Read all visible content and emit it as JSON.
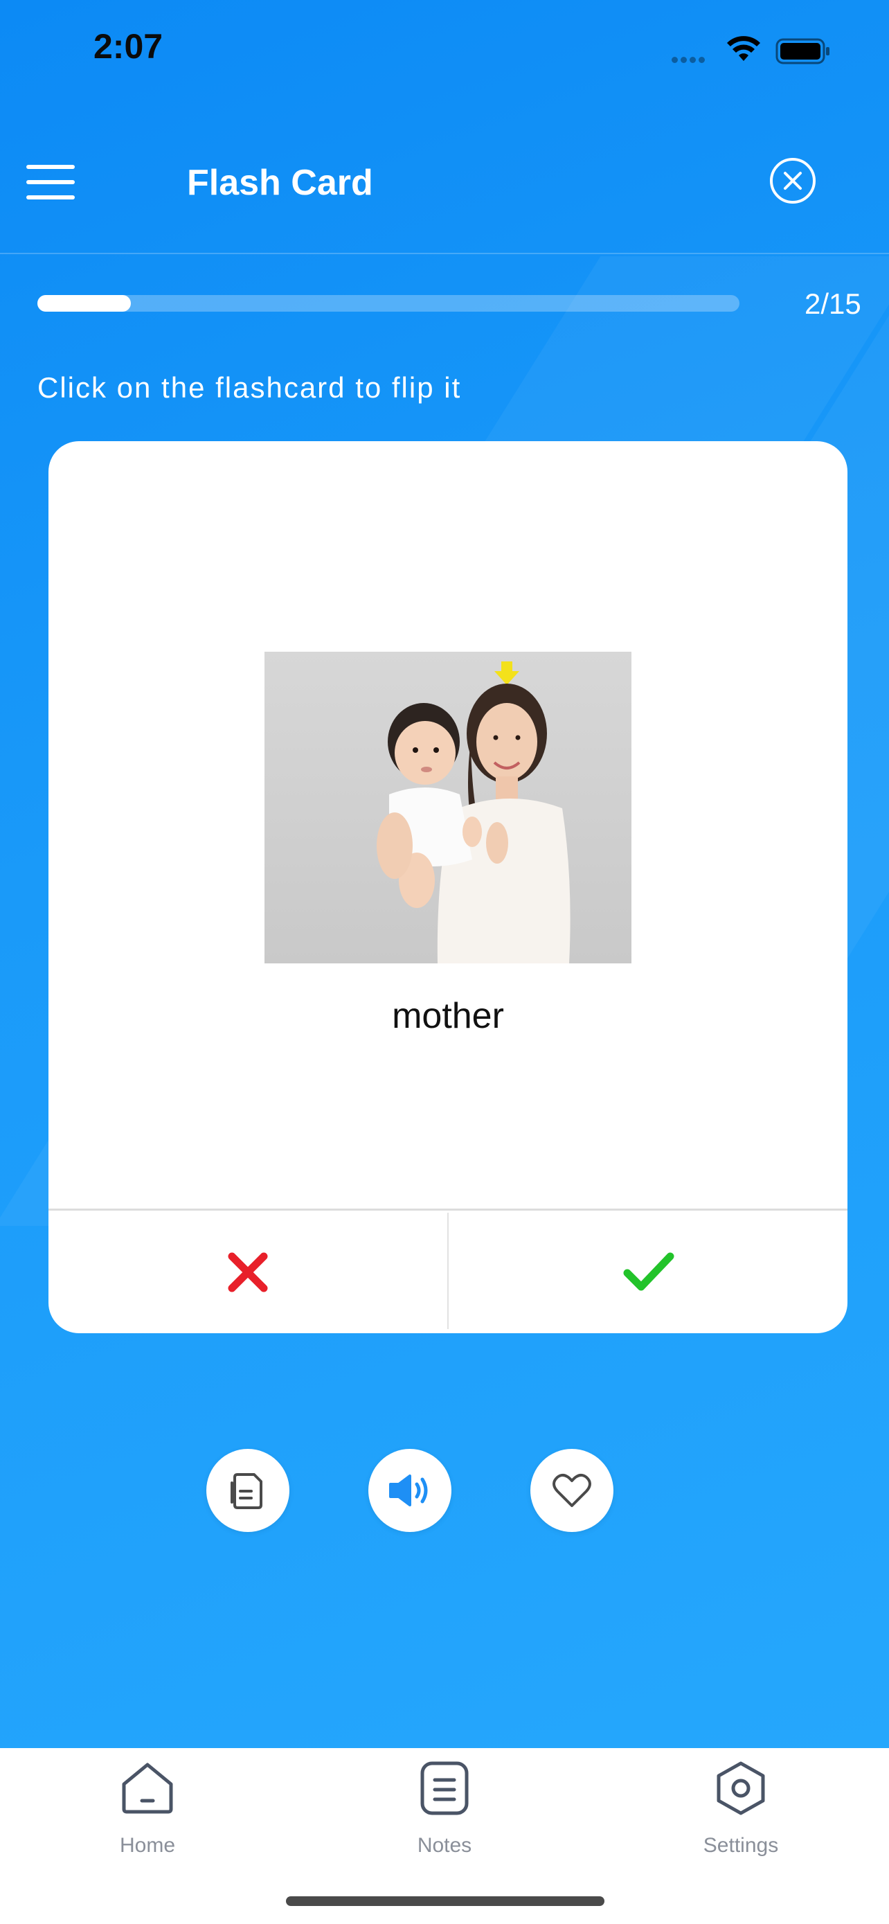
{
  "status_bar": {
    "time": "2:07"
  },
  "header": {
    "title": "Flash Card"
  },
  "progress": {
    "current": 2,
    "total": 15,
    "label": "2/15",
    "fraction": 0.1333
  },
  "instruction": "Click on the flashcard to flip it",
  "card": {
    "word": "mother",
    "image_icon": "mother-and-child-photo"
  },
  "answer_buttons": {
    "wrong_icon": "x-icon",
    "right_icon": "check-icon"
  },
  "actions": [
    {
      "icon": "note-icon"
    },
    {
      "icon": "speaker-icon"
    },
    {
      "icon": "heart-icon"
    }
  ],
  "tabs": [
    {
      "label": "Home",
      "icon": "home-icon"
    },
    {
      "label": "Notes",
      "icon": "notes-icon"
    },
    {
      "label": "Settings",
      "icon": "settings-icon"
    }
  ],
  "colors": {
    "background": "#1a9af9",
    "wrong": "#e8202a",
    "right": "#22c32a",
    "accent": "#1e8ff5",
    "tab_icon": "#4a5466"
  }
}
